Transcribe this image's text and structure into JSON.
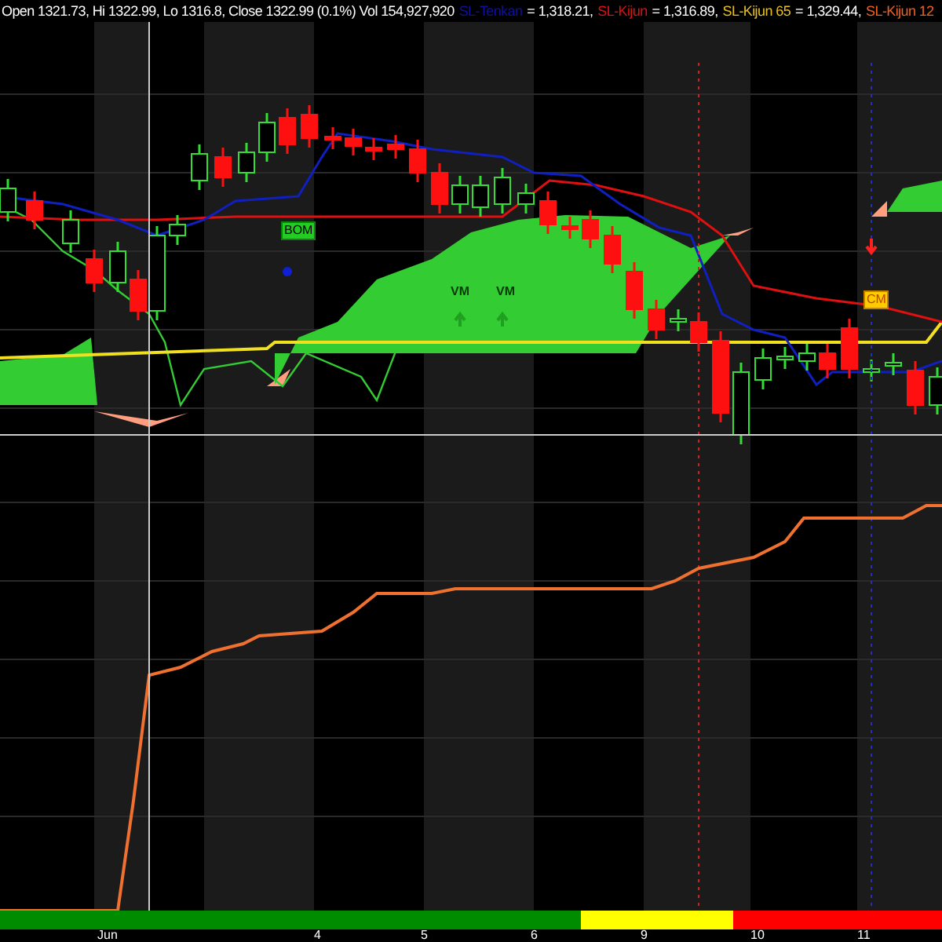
{
  "header": {
    "ohlc": "Open 1321.73, Hi 1322.99, Lo 1316.8, Close 1322.99 (0.1%) Vol 154,927,920",
    "indicators": [
      {
        "name": "SL-Tenkan",
        "value": "= 1,318.21,",
        "color": "#1010a0"
      },
      {
        "name": "SL-Kijun",
        "value": "= 1,316.89,",
        "color": "#e01010"
      },
      {
        "name": "SL-Kijun 65",
        "value": "= 1,329.44,",
        "color": "#e8c020"
      },
      {
        "name": "SL-Kijun 12",
        "color": "#f06020"
      }
    ]
  },
  "markers": [
    {
      "label": "BOM",
      "kind": "box"
    },
    {
      "label": "VM",
      "kind": "plain"
    },
    {
      "label": "VM",
      "kind": "plain"
    },
    {
      "label": "CM",
      "kind": "highlight"
    }
  ],
  "regime_bar": [
    {
      "color": "#008c00"
    },
    {
      "color": "#ffff00"
    },
    {
      "color": "#ff0000"
    }
  ],
  "x_axis": [
    "Jun",
    "4",
    "5",
    "6",
    "9",
    "10",
    "11"
  ]
}
